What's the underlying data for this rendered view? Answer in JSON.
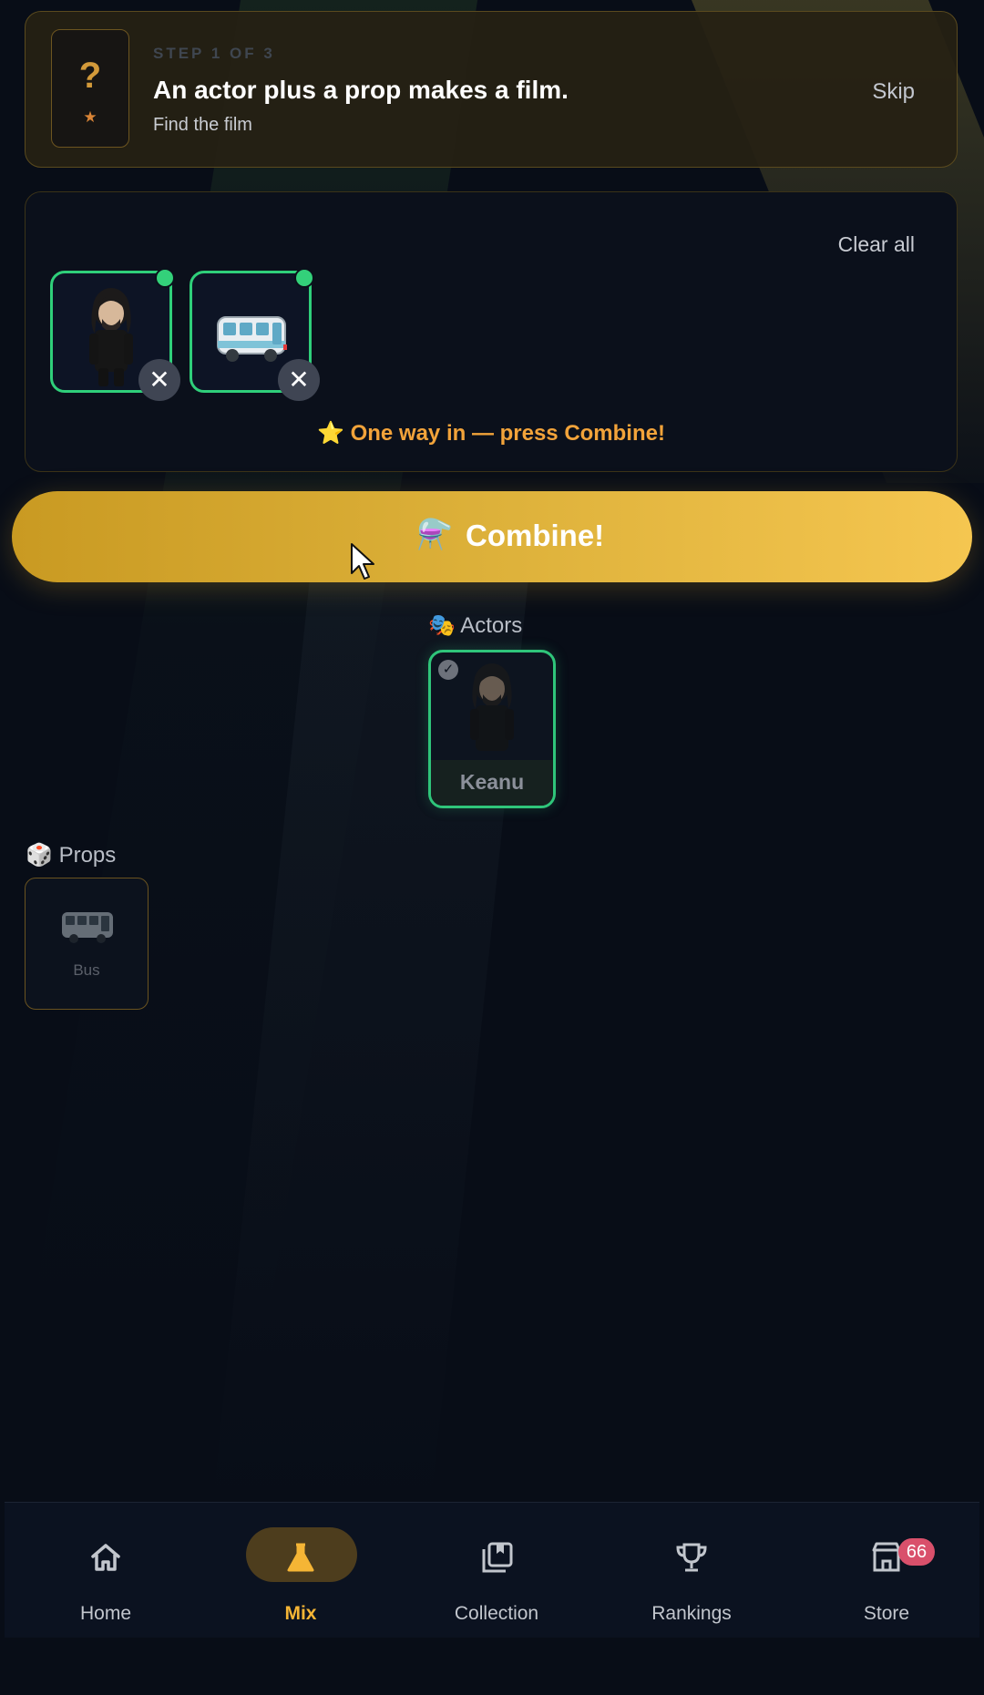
{
  "tutorial": {
    "step": "STEP 1 OF 3",
    "title": "An actor plus a prop makes a film.",
    "subtitle": "Find the film",
    "card_glyph": "?",
    "card_star": "★",
    "skip_label": "Skip"
  },
  "tray": {
    "clear_label": "Clear all",
    "slots": [
      {
        "item": "Keanu",
        "icon": "actor-portrait-icon"
      },
      {
        "item": "Bus",
        "icon": "bus-icon"
      }
    ],
    "remove_glyph": "✕",
    "hint": "⭐ One way in — press Combine!"
  },
  "combine": {
    "icon": "⚗️",
    "label": "Combine!"
  },
  "actors": {
    "heading_icon": "🎭",
    "heading": "Actors",
    "items": [
      {
        "name": "Keanu",
        "selected": true,
        "check": "✓"
      }
    ]
  },
  "props": {
    "heading_icon": "🎲",
    "heading": "Props",
    "items": [
      {
        "name": "Bus",
        "icon": "bus-icon"
      }
    ]
  },
  "nav": {
    "items": [
      {
        "label": "Home",
        "icon": "home-icon"
      },
      {
        "label": "Mix",
        "icon": "flask-icon",
        "active": true
      },
      {
        "label": "Collection",
        "icon": "collection-icon"
      },
      {
        "label": "Rankings",
        "icon": "trophy-icon"
      },
      {
        "label": "Store",
        "icon": "store-icon",
        "badge": "66"
      }
    ]
  },
  "colors": {
    "accent": "#f5b535",
    "selected_border": "#2fcf7a",
    "hint": "#f2a33a",
    "badge": "#d9506b"
  }
}
